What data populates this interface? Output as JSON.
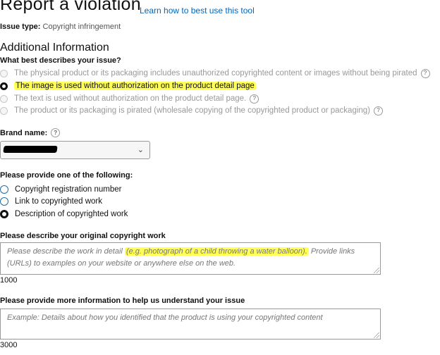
{
  "header": {
    "title": "Report a violation",
    "learn_link": "Learn how to best use this tool",
    "issue_type_label": "Issue type:",
    "issue_type_value": "Copyright infringement"
  },
  "additional": {
    "heading": "Additional Information",
    "question": "What best describes your issue?",
    "options": [
      {
        "label": "The physical product or its packaging includes unauthorized copyrighted content or images without being pirated",
        "selected": false
      },
      {
        "label": "The image is used without authorization on the product detail page",
        "selected": true
      },
      {
        "label": "The text is used without authorization on the product detail page.",
        "selected": false
      },
      {
        "label": "The product or its packaging is pirated (wholesale copying of the copyrighted product or packaging)",
        "selected": false
      }
    ],
    "help_glyph": "?"
  },
  "brand": {
    "label": "Brand name:",
    "value_redacted": true,
    "dropdown_icon": "chevron-down-icon"
  },
  "provide": {
    "label": "Please provide one of the following:",
    "options": [
      {
        "label": "Copyright registration number",
        "selected": false
      },
      {
        "label": "Link to copyrighted work",
        "selected": false
      },
      {
        "label": "Description of copyrighted work",
        "selected": true
      }
    ]
  },
  "describe": {
    "label": "Please describe your original copyright work",
    "placeholder_pre": "Please describe the work in detail ",
    "placeholder_highlight": "(e.g. photograph of a child throwing a water balloon).",
    "placeholder_post": " Provide links (URLs) to examples on your website or anywhere else on the web.",
    "char_count": "1000"
  },
  "more_info": {
    "label": "Please provide more information to help us understand your issue",
    "placeholder": "Example: Details about how you identified that the product is using your copyrighted content",
    "char_count": "3000"
  },
  "colors": {
    "link": "#0066c0",
    "highlight": "#ffff57"
  }
}
